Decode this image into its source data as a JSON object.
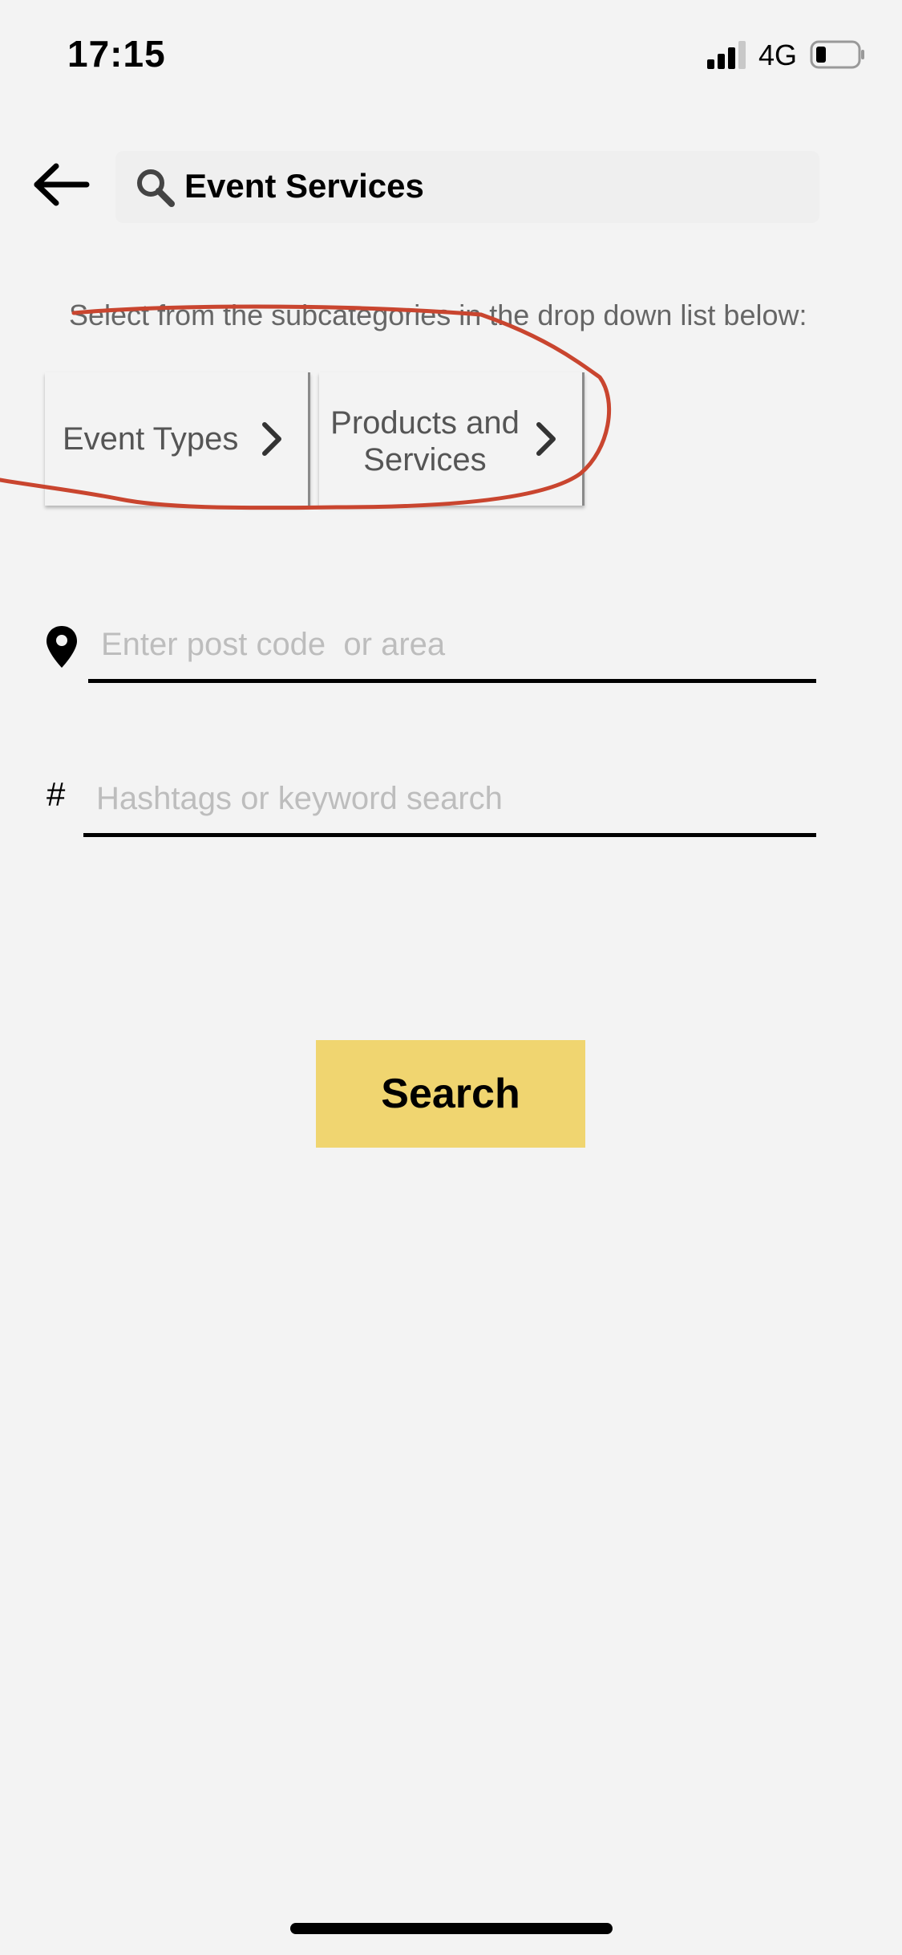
{
  "status_bar": {
    "time": "17:15",
    "network": "4G",
    "signal_icon": "cellular-signal-icon",
    "battery_icon": "battery-low-icon"
  },
  "header": {
    "back_icon": "arrow-left-icon",
    "search_icon": "magnifier-icon",
    "search_query": "Event Services"
  },
  "instruction": "Select from the subcategories in the drop down list below:",
  "subcategories": [
    {
      "label": "Event Types",
      "icon": "chevron-right-icon"
    },
    {
      "label": "Products and Services",
      "icon": "chevron-right-icon"
    }
  ],
  "location": {
    "icon": "map-pin-icon",
    "value": "",
    "placeholder": "Enter post code  or area"
  },
  "keywords": {
    "icon_glyph": "#",
    "value": "",
    "placeholder": "Hashtags or keyword search"
  },
  "search_button": {
    "label": "Search"
  },
  "colors": {
    "background": "#f3f3f3",
    "search_button": "#f0d570",
    "annotation_stroke": "#c9452f",
    "placeholder": "#bdbdbd"
  }
}
